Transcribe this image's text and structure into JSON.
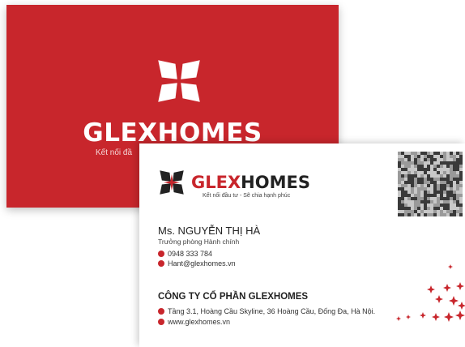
{
  "brand": {
    "name_red_part": "GLEX",
    "name_dark_part": "HOMES",
    "back_name": "GLEXHOMES",
    "back_tagline": "Kết nối đầ",
    "front_tagline": "Kết nối đầu tư - Sẽ chia hạnh phúc"
  },
  "person": {
    "name": "Ms. NGUYỄN THỊ HÀ",
    "title": "Trưởng phòng Hành chính",
    "phone": "0948 333 784",
    "email": "Hant@glexhomes.vn"
  },
  "company": {
    "name": "CÔNG TY CỔ PHẦN GLEXHOMES",
    "address": "Tầng 3.1, Hoàng Cầu Skyline, 36 Hoàng Cầu, Đống Đa, Hà Nội.",
    "website": "www.glexhomes.vn"
  },
  "colors": {
    "accent": "#c8262c",
    "dark": "#222222"
  },
  "icons": [
    "phone-icon",
    "email-icon",
    "location-icon",
    "globe-icon",
    "qr-code-icon",
    "sparkle-icon"
  ]
}
